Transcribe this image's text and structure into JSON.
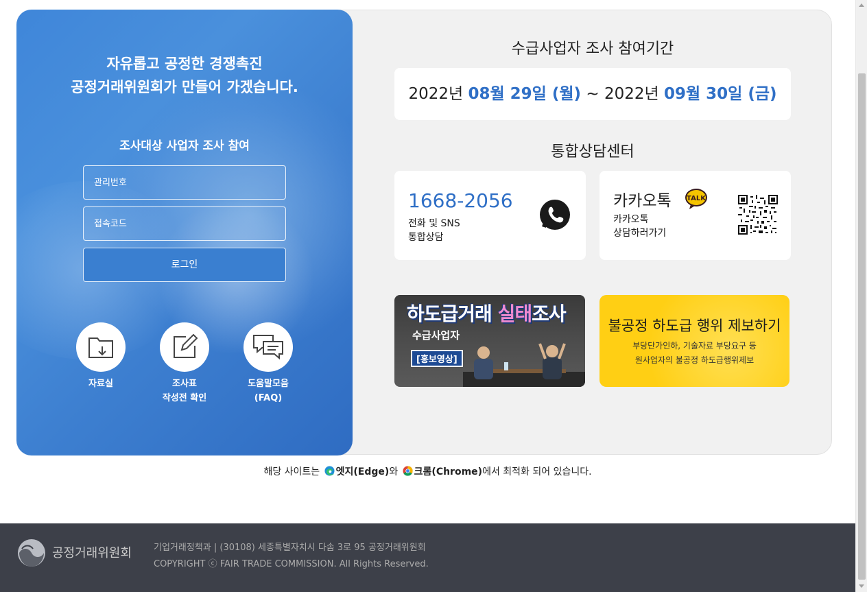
{
  "left": {
    "slogan_line1": "자유롭고 공정한 경쟁촉진",
    "slogan_line2": "공정거래위원회가 만들어 가겠습니다.",
    "login_title": "조사대상 사업자 조사 참여",
    "id_placeholder": "관리번호",
    "code_placeholder": "접속코드",
    "login_button": "로그인",
    "quick_links": [
      {
        "label": "자료실",
        "icon": "folder-download-icon"
      },
      {
        "label_line1": "조사표",
        "label_line2": "작성전 확인",
        "icon": "edit-icon"
      },
      {
        "label_line1": "도움말모음",
        "label_line2": "(FAQ)",
        "icon": "chat-bubbles-icon"
      }
    ]
  },
  "period": {
    "title": "수급사업자 조사 참여기간",
    "start_year": "2022년",
    "start_date": "08월 29일 (월)",
    "separator": "~",
    "end_year": "2022년",
    "end_date": "09월 30일 (금)"
  },
  "center": {
    "title": "통합상담센터",
    "phone": {
      "number": "1668-2056",
      "line1": "전화 및 SNS",
      "line2": "통합상담",
      "icon": "phone-icon"
    },
    "kakao": {
      "name": "카카오톡",
      "badge": "TALK",
      "line1": "카카오톡",
      "line2": "상담하러가기",
      "icon": "qr-code-icon"
    }
  },
  "banners": {
    "video": {
      "title_a": "하도급거래 ",
      "title_b": "실태",
      "title_c": "조사",
      "sub": "수급사업자",
      "tag": "[홍보영상]"
    },
    "report": {
      "title": "불공정 하도급 행위 제보하기",
      "line1": "부당단가인하, 기술자료 부당요구 등",
      "line2": "원사업자의 불공정 하도급행위제보"
    }
  },
  "browser_note": {
    "prefix": "해당 사이트는",
    "edge": "엣지(Edge)",
    "mid": "와",
    "chrome": "크롬(Chrome)",
    "suffix": "에서 최적화 되어 있습니다."
  },
  "footer": {
    "org": "공정거래위원회",
    "address": "기업거래정책과 | (30108) 세종특별자치시 다솜 3로 95 공정거래위원회",
    "copyright": "COPYRIGHT ⓒ FAIR TRADE COMMISSION. All Rights Reserved."
  },
  "colors": {
    "brand_blue": "#2f6fc6",
    "report_yellow": "#ffcf14",
    "footer_bg": "#3d4049"
  }
}
